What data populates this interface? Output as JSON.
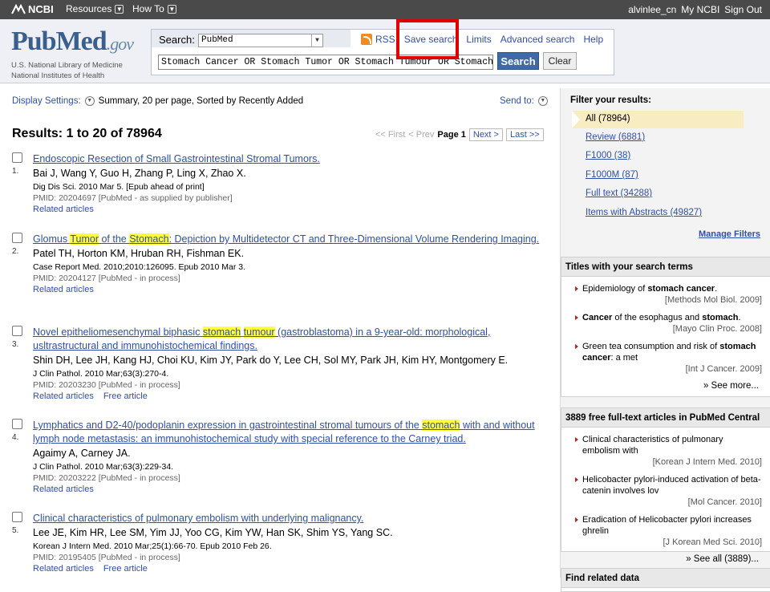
{
  "topbar": {
    "brand": "NCBI",
    "resources": "Resources",
    "howto": "How To",
    "user": "alvinlee_cn",
    "my_ncbi": "My NCBI",
    "sign_out": "Sign Out"
  },
  "header": {
    "logo_main": "PubMed",
    "logo_gov": ".gov",
    "logo_sub1": "U.S. National Library of Medicine",
    "logo_sub2": "National Institutes of Health",
    "search_label": "Search:",
    "db_value": "PubMed",
    "query": "Stomach Cancer OR Stomach Tumor OR Stomach Tumour OR Stomach Neoplasm",
    "search_btn": "Search",
    "clear_btn": "Clear",
    "links": {
      "rss": "RSS",
      "save": "Save search",
      "limits": "Limits",
      "advanced": "Advanced search",
      "help": "Help"
    }
  },
  "display": {
    "settings": "Display Settings:",
    "summary": "Summary, 20 per page, Sorted by Recently Added",
    "send_to": "Send to:"
  },
  "results_title": "Results: 1 to 20 of 78964",
  "pager": {
    "first": "<< First",
    "prev": "< Prev",
    "page": "Page 1",
    "next": "Next >",
    "last": "Last >>"
  },
  "results": [
    {
      "num": "1.",
      "title_parts": [
        {
          "t": "Endoscopic Resection of Small Gastrointestinal Stromal Tumors."
        }
      ],
      "authors": "Bai J, Wang Y, Guo H, Zhang P, Ling X, Zhao X.",
      "cit": "Dig Dis Sci. 2010 Mar 5. [Epub ahead of print]",
      "pmid": "PMID: 20204697 [PubMed - as supplied by publisher]",
      "links": [
        "Related articles"
      ]
    },
    {
      "num": "2.",
      "title_parts": [
        {
          "t": "Glomus "
        },
        {
          "t": "Tumor",
          "hl": true
        },
        {
          "t": " of the "
        },
        {
          "t": "Stomach",
          "hl": true
        },
        {
          "t": ": Depiction by Multidetector CT and Three-Dimensional Volume Rendering Imaging."
        }
      ],
      "authors": "Patel TH, Horton KM, Hruban RH, Fishman EK.",
      "cit": "Case Report Med. 2010;2010:126095. Epub 2010 Mar 3.",
      "pmid": "PMID: 20204127 [PubMed - in process]",
      "links": [
        "Related articles"
      ]
    },
    {
      "num": "3.",
      "title_parts": [
        {
          "t": "Novel epitheliomesenchymal biphasic "
        },
        {
          "t": "stomach",
          "hl": true
        },
        {
          "t": " "
        },
        {
          "t": "tumour",
          "hl": true
        },
        {
          "t": " (gastroblastoma) in a 9-year-old: morphological, usltrastructural and immunohistochemical findings."
        }
      ],
      "authors": "Shin DH, Lee JH, Kang HJ, Choi KU, Kim JY, Park do Y, Lee CH, Sol MY, Park JH, Kim HY, Montgomery E.",
      "cit": "J Clin Pathol. 2010 Mar;63(3):270-4.",
      "pmid": "PMID: 20203230 [PubMed - in process]",
      "links": [
        "Related articles",
        "Free article"
      ]
    },
    {
      "num": "4.",
      "title_parts": [
        {
          "t": "Lymphatics and D2-40/podoplanin expression in gastrointestinal stromal tumours of the "
        },
        {
          "t": "stomach",
          "hl": true
        },
        {
          "t": " with and without lymph node metastasis: an immunohistochemical study with special reference to the Carney triad."
        }
      ],
      "authors": "Agaimy A, Carney JA.",
      "cit": "J Clin Pathol. 2010 Mar;63(3):229-34.",
      "pmid": "PMID: 20203222 [PubMed - in process]",
      "links": [
        "Related articles"
      ]
    },
    {
      "num": "5.",
      "title_parts": [
        {
          "t": "Clinical characteristics of pulmonary embolism with underlying malignancy."
        }
      ],
      "authors": "Lee JE, Kim HR, Lee SM, Yim JJ, Yoo CG, Kim YW, Han SK, Shim YS, Yang SC.",
      "cit": "Korean J Intern Med. 2010 Mar;25(1):66-70. Epub 2010 Feb 26.",
      "pmid": "PMID: 20195405 [PubMed - in process]",
      "links": [
        "Related articles",
        "Free article"
      ]
    }
  ],
  "sidebar": {
    "filter_title": "Filter your results:",
    "filters": [
      "All (78964)",
      "Review (6881)",
      "F1000 (38)",
      "F1000M (87)",
      "Full text (34288)",
      "Items with Abstracts (49827)"
    ],
    "manage": "Manage Filters",
    "titles_panel": {
      "header": "Titles with your search terms",
      "items": [
        {
          "parts": [
            {
              "t": "Epidemiology of "
            },
            {
              "t": "stomach cancer",
              "b": true
            },
            {
              "t": "."
            }
          ],
          "src": "[Methods Mol Biol. 2009]"
        },
        {
          "parts": [
            {
              "t": "Cancer",
              "b": true
            },
            {
              "t": " of the esophagus and "
            },
            {
              "t": "stomach",
              "b": true
            },
            {
              "t": "."
            }
          ],
          "src": "[Mayo Clin Proc. 2008]"
        },
        {
          "parts": [
            {
              "t": "Green tea consumption and risk of "
            },
            {
              "t": "stomach cancer",
              "b": true
            },
            {
              "t": ": a met"
            }
          ],
          "src": "[Int J Cancer. 2009]"
        }
      ],
      "more": "» See more..."
    },
    "pmc_panel": {
      "header": "3889 free full-text articles in PubMed Central",
      "items": [
        {
          "parts": [
            {
              "t": "Clinical characteristics of pulmonary embolism with"
            }
          ],
          "src": "[Korean J Intern Med. 2010]"
        },
        {
          "parts": [
            {
              "t": "Helicobacter pylori-induced activation of beta-catenin involves lov"
            }
          ],
          "src": "[Mol Cancer. 2010]"
        },
        {
          "parts": [
            {
              "t": "Eradication of Helicobacter pylori increases ghrelin"
            }
          ],
          "src": "[J Korean Med Sci. 2010]"
        }
      ],
      "more": "» See all (3889)..."
    },
    "bottom_panel": {
      "header": "Find related data"
    }
  }
}
